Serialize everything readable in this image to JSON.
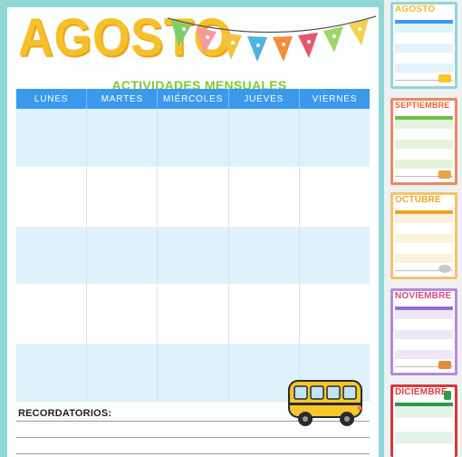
{
  "planner": {
    "title": "AGOSTO",
    "subtitle": "ACTIVIDADES MENSUALES",
    "days": [
      "LUNES",
      "MARTES",
      "MIÉRCOLES",
      "JUEVES",
      "VIERNES"
    ],
    "reminders_label": "RECORDATORIOS:",
    "colors": {
      "frame": "#8fd7d6",
      "title": "#f6c02a",
      "subtitle": "#7acb33",
      "header": "#3a99ec",
      "row_alt": "#dff1fb"
    }
  },
  "thumbnails": [
    {
      "title": "AGOSTO",
      "color": "#f2b820",
      "frame": "#8fd7d6",
      "band": "#3a99ec",
      "row": "#e4f2fb",
      "deco": "bus-icon"
    },
    {
      "title": "SEPTIEMBRE",
      "color": "#e8622e",
      "frame": "#e88a63",
      "band": "#6fbf44",
      "row": "#e6f3dc",
      "deco": "tacos-icon"
    },
    {
      "title": "OCTUBRE",
      "color": "#f0a224",
      "frame": "#f4c26d",
      "band": "#f0a224",
      "row": "#fdf1dc",
      "deco": "leaf-icon"
    },
    {
      "title": "NOVIEMBRE",
      "color": "#d14a7d",
      "frame": "#b48ad9",
      "band": "#9b6ccf",
      "row": "#efe6f8",
      "deco": "skull-icon"
    },
    {
      "title": "DICIEMBRE",
      "color": "#e23b3b",
      "frame": "#d8393a",
      "band": "#2e9a4c",
      "row": "#e3f3e7",
      "deco": "tree-icon"
    }
  ]
}
